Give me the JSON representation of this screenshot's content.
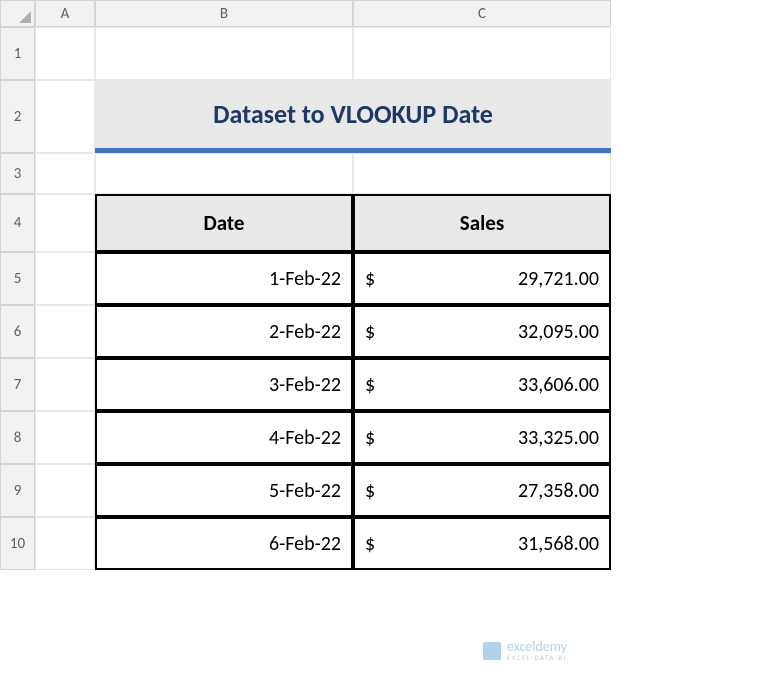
{
  "columns": {
    "A": "A",
    "B": "B",
    "C": "C"
  },
  "rows": {
    "r1": "1",
    "r2": "2",
    "r3": "3",
    "r4": "4",
    "r5": "5",
    "r6": "6",
    "r7": "7",
    "r8": "8",
    "r9": "9",
    "r10": "10"
  },
  "title": "Dataset to VLOOKUP Date",
  "headers": {
    "date": "Date",
    "sales": "Sales"
  },
  "currency": "$",
  "data": [
    {
      "date": "1-Feb-22",
      "sales": "29,721.00"
    },
    {
      "date": "2-Feb-22",
      "sales": "32,095.00"
    },
    {
      "date": "3-Feb-22",
      "sales": "33,606.00"
    },
    {
      "date": "4-Feb-22",
      "sales": "33,325.00"
    },
    {
      "date": "5-Feb-22",
      "sales": "27,358.00"
    },
    {
      "date": "6-Feb-22",
      "sales": "31,568.00"
    }
  ],
  "watermark": {
    "name": "exceldemy",
    "sub": "EXCEL·DATA·BI"
  },
  "chart_data": {
    "type": "table",
    "title": "Dataset to VLOOKUP Date",
    "columns": [
      "Date",
      "Sales"
    ],
    "rows": [
      [
        "1-Feb-22",
        29721.0
      ],
      [
        "2-Feb-22",
        32095.0
      ],
      [
        "3-Feb-22",
        33606.0
      ],
      [
        "4-Feb-22",
        33325.0
      ],
      [
        "5-Feb-22",
        27358.0
      ],
      [
        "6-Feb-22",
        31568.0
      ]
    ]
  }
}
